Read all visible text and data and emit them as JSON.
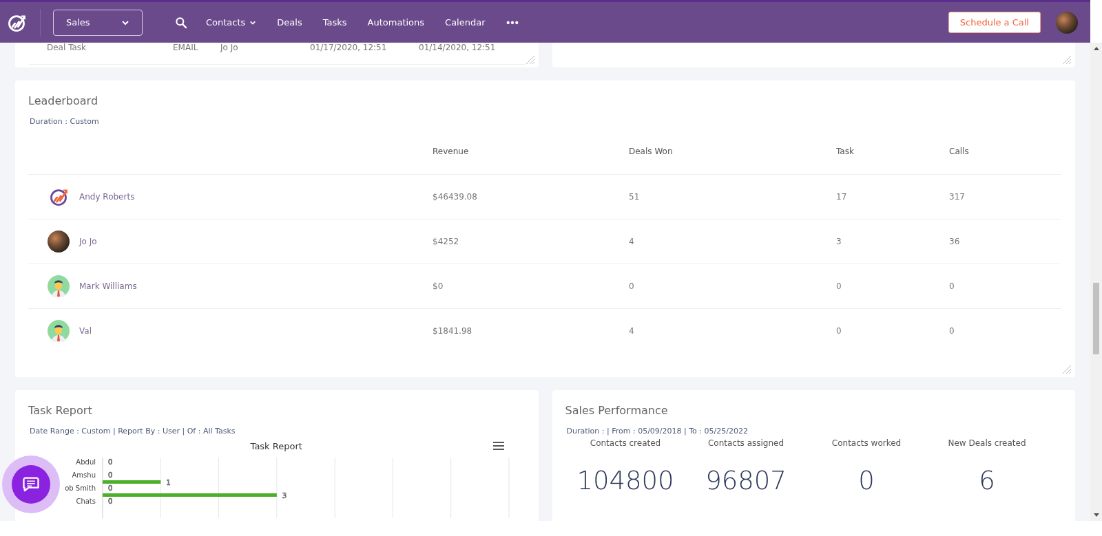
{
  "nav": {
    "module_select": "Sales",
    "items": [
      {
        "label": "Contacts",
        "dropdown": true
      },
      {
        "label": "Deals",
        "dropdown": false
      },
      {
        "label": "Tasks",
        "dropdown": false
      },
      {
        "label": "Automations",
        "dropdown": false
      },
      {
        "label": "Calendar",
        "dropdown": false
      }
    ],
    "cta": "Schedule a Call"
  },
  "tasks_card": {
    "rows": [
      {
        "cells": [
          "Deal Task",
          "EMAIL",
          "Jo Jo",
          "01/17/2020, 12:51",
          "01/14/2020, 12:51"
        ]
      }
    ]
  },
  "leaderboard": {
    "title": "Leaderboard",
    "subtitle": "Duration : Custom",
    "columns": [
      "Revenue",
      "Deals Won",
      "Task",
      "Calls"
    ],
    "rows": [
      {
        "name": "Andy Roberts",
        "kind": "logo",
        "values": [
          "$46439.08",
          "51",
          "17",
          "317"
        ]
      },
      {
        "name": "Jo Jo",
        "kind": "photo",
        "values": [
          "$4252",
          "4",
          "3",
          "36"
        ]
      },
      {
        "name": "Mark Williams",
        "kind": "person",
        "values": [
          "$0",
          "0",
          "0",
          "0"
        ]
      },
      {
        "name": "Val",
        "kind": "person",
        "values": [
          "$1841.98",
          "4",
          "0",
          "0"
        ]
      }
    ]
  },
  "task_report": {
    "title": "Task Report",
    "subtitle": "Date Range : Custom | Report By : User | Of : All Tasks",
    "chart_data": {
      "type": "bar",
      "orientation": "horizontal",
      "title": "Task Report",
      "categories": [
        "Abdul",
        "Amshu",
        "ob Smith",
        "Chats"
      ],
      "xlim": [
        0,
        7
      ],
      "data_labels": true,
      "series": [
        {
          "values": [
            0,
            0,
            0,
            0
          ]
        },
        {
          "color": "#4caf2a",
          "values": [
            null,
            1,
            3,
            null
          ]
        }
      ]
    }
  },
  "sales_performance": {
    "title": "Sales Performance",
    "subtitle": "Duration : | From : 05/09/2018 | To : 05/25/2022",
    "metrics": [
      {
        "label": "Contacts created",
        "value": "104800"
      },
      {
        "label": "Contacts assigned",
        "value": "96807"
      },
      {
        "label": "Contacts worked",
        "value": "0"
      },
      {
        "label": "New Deals created",
        "value": "6"
      }
    ]
  }
}
